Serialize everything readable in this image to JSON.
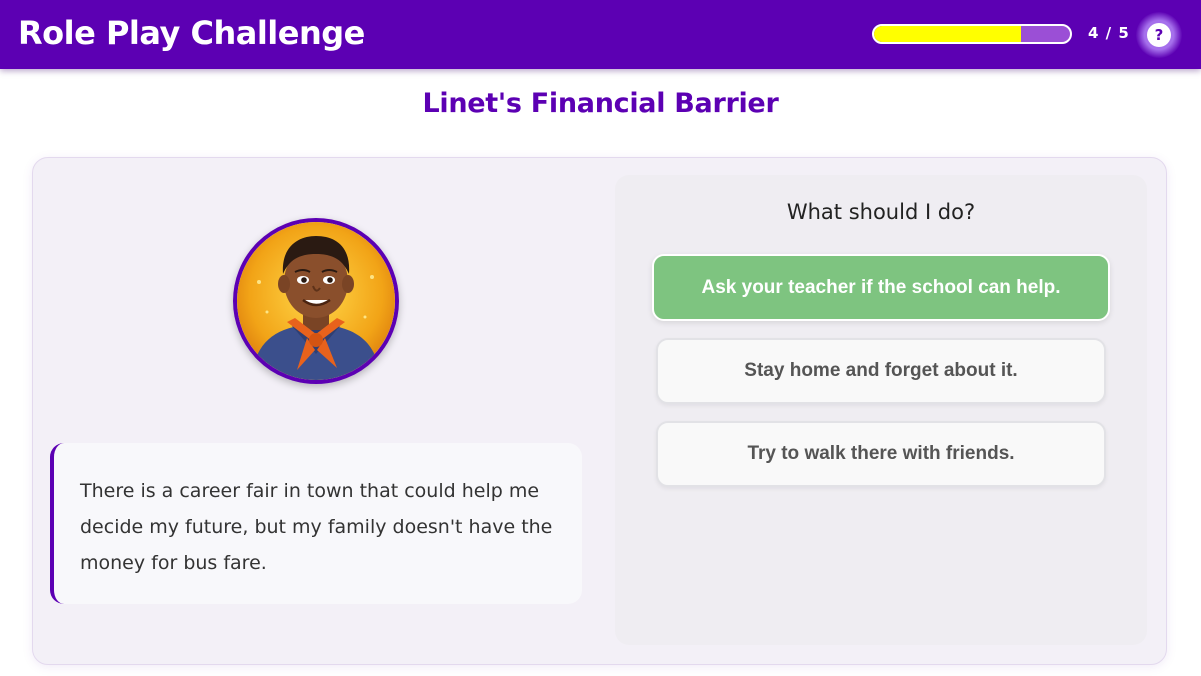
{
  "header": {
    "title": "Role Play Challenge",
    "progress": {
      "current": 4,
      "total": 5,
      "fill_fraction": 0.75,
      "label": "4 / 5"
    },
    "help_label": "?"
  },
  "scenario": {
    "title": "Linet's Financial Barrier",
    "character_avatar": "boy-with-orange-neckerchief-illustration",
    "speech": "There is a career fair in town that could help me decide my future, but my family doesn't have the money for bus fare."
  },
  "choices": {
    "prompt": "What should I do?",
    "options": [
      {
        "label": "Ask your teacher if the school can help.",
        "state": "selected"
      },
      {
        "label": "Stay home and forget about it.",
        "state": "default"
      },
      {
        "label": "Try to walk there with friends.",
        "state": "default"
      }
    ]
  },
  "colors": {
    "brand": "#5c00b3",
    "progress_fill": "#ffff00",
    "selected_option": "#7ec480"
  }
}
